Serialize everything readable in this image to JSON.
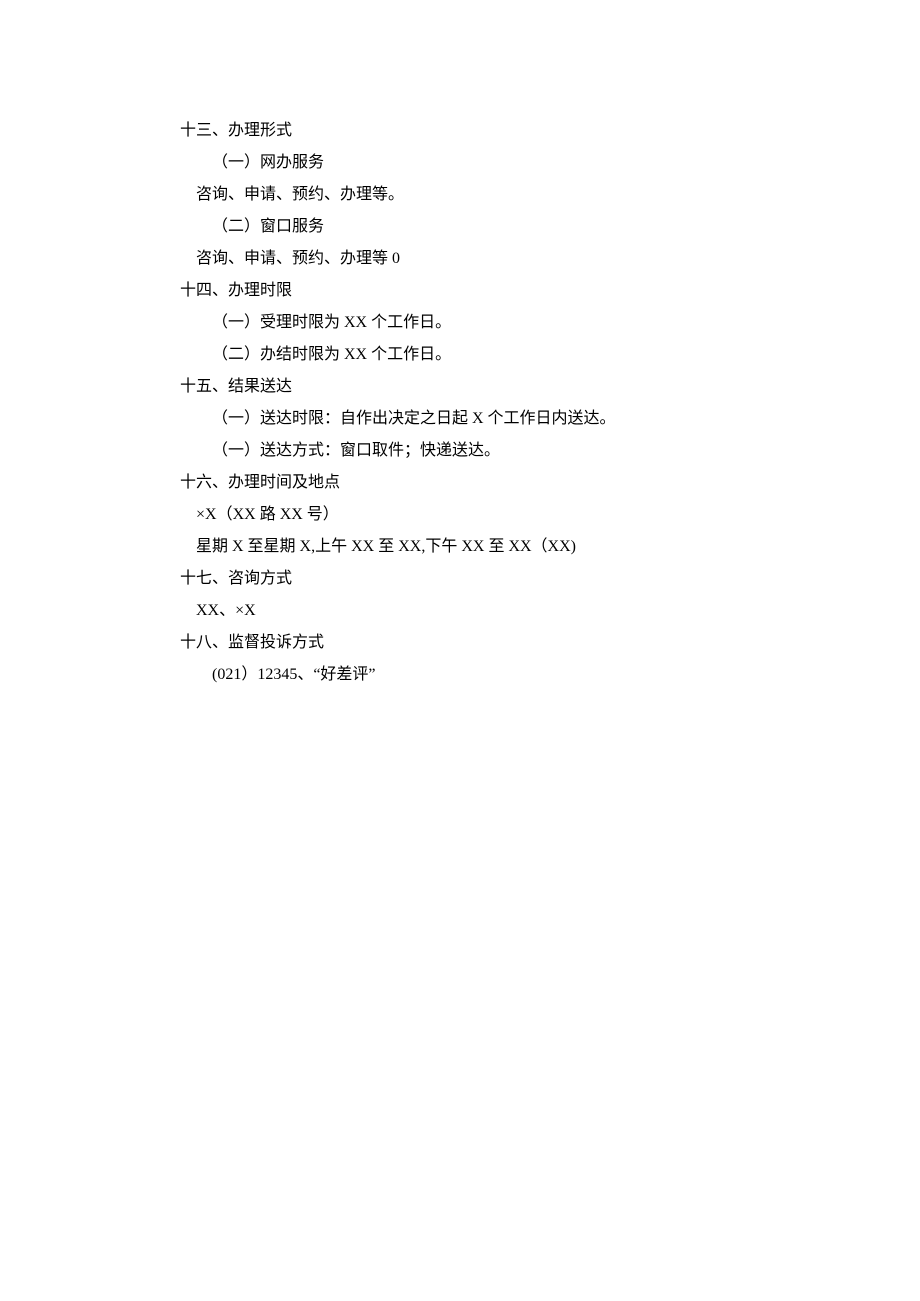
{
  "sections": {
    "s13": {
      "heading": "十三、办理形式",
      "item1": "（一）网办服务",
      "item1_detail": "咨询、申请、预约、办理等。",
      "item2": "（二）窗口服务",
      "item2_detail": "咨询、申请、预约、办理等 0"
    },
    "s14": {
      "heading": "十四、办理时限",
      "item1": "（一）受理时限为 XX 个工作日。",
      "item2": "（二）办结时限为 XX 个工作日。"
    },
    "s15": {
      "heading": "十五、结果送达",
      "item1": "（一）送达时限：自作出决定之日起 X 个工作日内送达。",
      "item2": "（一）送达方式：窗口取件；快递送达。"
    },
    "s16": {
      "heading": "十六、办理时间及地点",
      "line1": "×X（XX 路 XX 号）",
      "line2": "星期 X 至星期 X,上午 XX 至 XX,下午 XX 至 XX（XX)"
    },
    "s17": {
      "heading": "十七、咨询方式",
      "line1": "XX、×X"
    },
    "s18": {
      "heading": "十八、监督投诉方式",
      "line1": "(021）12345、“好差评”"
    }
  }
}
